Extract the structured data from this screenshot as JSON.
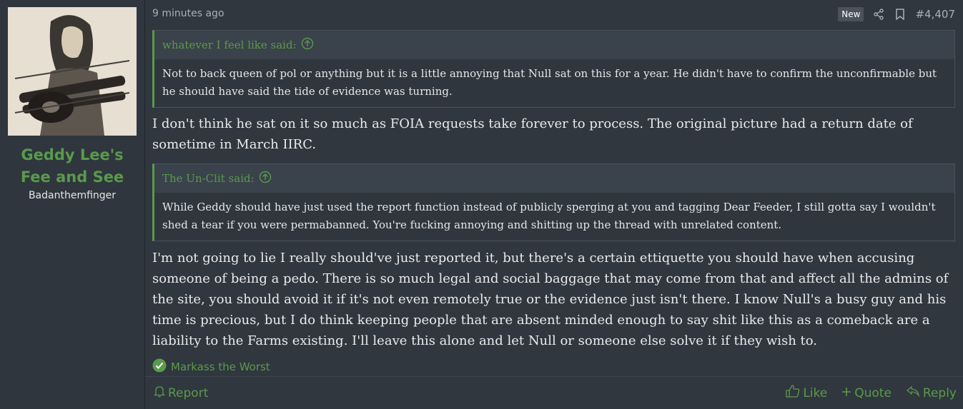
{
  "user": {
    "name": "Geddy Lee's Fee and See",
    "title": "Badanthemfinger"
  },
  "post": {
    "timestamp": "9 minutes ago",
    "badge": "New",
    "number": "#4,407",
    "quote1": {
      "author": "whatever I feel like said:",
      "text": "Not to back queen of pol or anything but it is a little annoying that Null sat on this for a year. He didn't have to confirm the unconfirmable but he should have said the tide of evidence was turning."
    },
    "reply1": "I don't think he sat on it so much as FOIA requests take forever to process. The original picture had a return date of sometime in March IIRC.",
    "quote2": {
      "author": "The Un-Clit said:",
      "text": "While Geddy should have just used the report function instead of publicly sperging at you and tagging Dear Feeder, I still gotta say I wouldn't shed a tear if you were permabanned. You're fucking annoying and shitting up the thread with unrelated content."
    },
    "reply2": "I'm not going to lie I really should've just reported it, but there's a certain ettiquette you should have when accusing someone of being a pedo. There is so much legal and social baggage that may come from that and affect all the admins of the site, you should avoid it if it's not even remotely true or the evidence just isn't there. I know Null's a busy guy and his time is precious, but I do think keeping people that are absent minded enough to say shit like this as a comeback are a liability to the Farms existing. I'll leave this alone and let Null or someone else solve it if they wish to.",
    "reaction": "Markass the Worst"
  },
  "actions": {
    "report": "Report",
    "like": "Like",
    "quote": "Quote",
    "reply": "Reply"
  },
  "colors": {
    "accent": "#5a9a4a",
    "background": "#30373f",
    "text": "#eaeaea"
  },
  "icons": {
    "share": "share-icon",
    "bookmark": "bookmark-icon",
    "expand": "arrow-up-circle-icon",
    "reaction": "checkmark-circle-icon",
    "report": "bell-icon",
    "like": "thumbs-up-icon",
    "quote": "plus-icon",
    "reply": "reply-arrow-icon"
  }
}
